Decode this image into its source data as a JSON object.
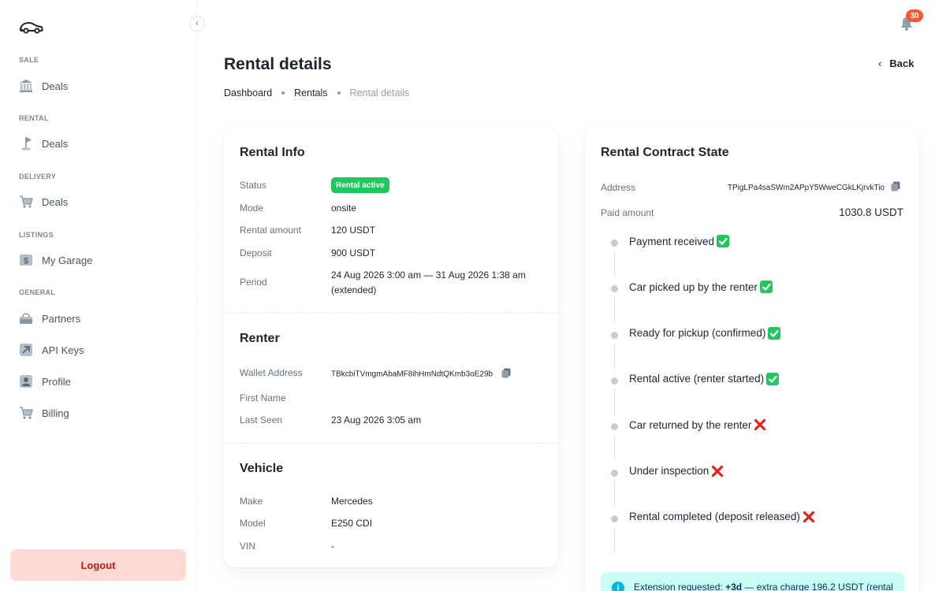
{
  "sidebar": {
    "collapse_glyph": "‹",
    "sections": [
      {
        "label": "SALE",
        "item": "Deals",
        "icon": "bank-icon"
      },
      {
        "label": "RENTAL",
        "item": "Deals",
        "icon": "flag-icon"
      },
      {
        "label": "DELIVERY",
        "item": "Deals",
        "icon": "cart-icon"
      },
      {
        "label": "LISTINGS",
        "item": "My Garage",
        "icon": "dollar-icon"
      }
    ],
    "general_label": "GENERAL",
    "general_items": [
      {
        "label": "Partners",
        "icon": "bag-icon"
      },
      {
        "label": "API Keys",
        "icon": "arrow-icon"
      },
      {
        "label": "Profile",
        "icon": "user-icon"
      },
      {
        "label": "Billing",
        "icon": "cart-icon"
      }
    ],
    "logout_label": "Logout"
  },
  "header": {
    "notifications_count": "30",
    "title": "Rental details",
    "back_label": "Back",
    "breadcrumb": [
      "Dashboard",
      "Rentals",
      "Rental details"
    ]
  },
  "rental_info": {
    "title": "Rental Info",
    "status_label": "Status",
    "status_value": "Rental active",
    "mode_label": "Mode",
    "mode_value": "onsite",
    "amount_label": "Rental amount",
    "amount_value": "120 USDT",
    "deposit_label": "Deposit",
    "deposit_value": "900 USDT",
    "period_label": "Period",
    "period_line1": "24 Aug 2026 3:00 am — 31 Aug 2026 1:38 am",
    "period_line2": "(extended)"
  },
  "renter": {
    "title": "Renter",
    "wallet_label": "Wallet Address",
    "wallet_value": "TBkcbiTVmgmAbaMF8ihHmNdtQKmb3oE29b",
    "first_name_label": "First Name",
    "first_name_value": "",
    "last_seen_label": "Last Seen",
    "last_seen_value": "23 Aug 2026 3:05 am"
  },
  "vehicle": {
    "title": "Vehicle",
    "make_label": "Make",
    "make_value": "Mercedes",
    "model_label": "Model",
    "model_value": "E250 CDI",
    "vin_label": "VIN",
    "vin_value": "-"
  },
  "contract": {
    "title": "Rental Contract State",
    "address_label": "Address",
    "address_value": "TPigLPa4saSWm2APpY5WweCGkLKjrvkTio",
    "paid_label": "Paid amount",
    "paid_value": "1030.8 USDT",
    "steps": [
      {
        "label": "Payment received",
        "done": true
      },
      {
        "label": "Car picked up by the renter",
        "done": true
      },
      {
        "label": "Ready for pickup (confirmed)",
        "done": true
      },
      {
        "label": "Rental active (renter started)",
        "done": true
      },
      {
        "label": "Car returned by the renter",
        "done": false
      },
      {
        "label": "Under inspection",
        "done": false
      },
      {
        "label": "Rental completed (deposit released)",
        "done": false
      }
    ],
    "info_prefix": "Extension requested: ",
    "info_bold": "+3d",
    "info_suffix": " — extra charge 196.2 USDT (rental"
  },
  "colors": {
    "accent_green": "#22c55e",
    "danger_red": "#e0241a",
    "logout_bg": "#ffd9d3",
    "info_bg": "#cafdf5",
    "badge_red": "#ff5630"
  }
}
